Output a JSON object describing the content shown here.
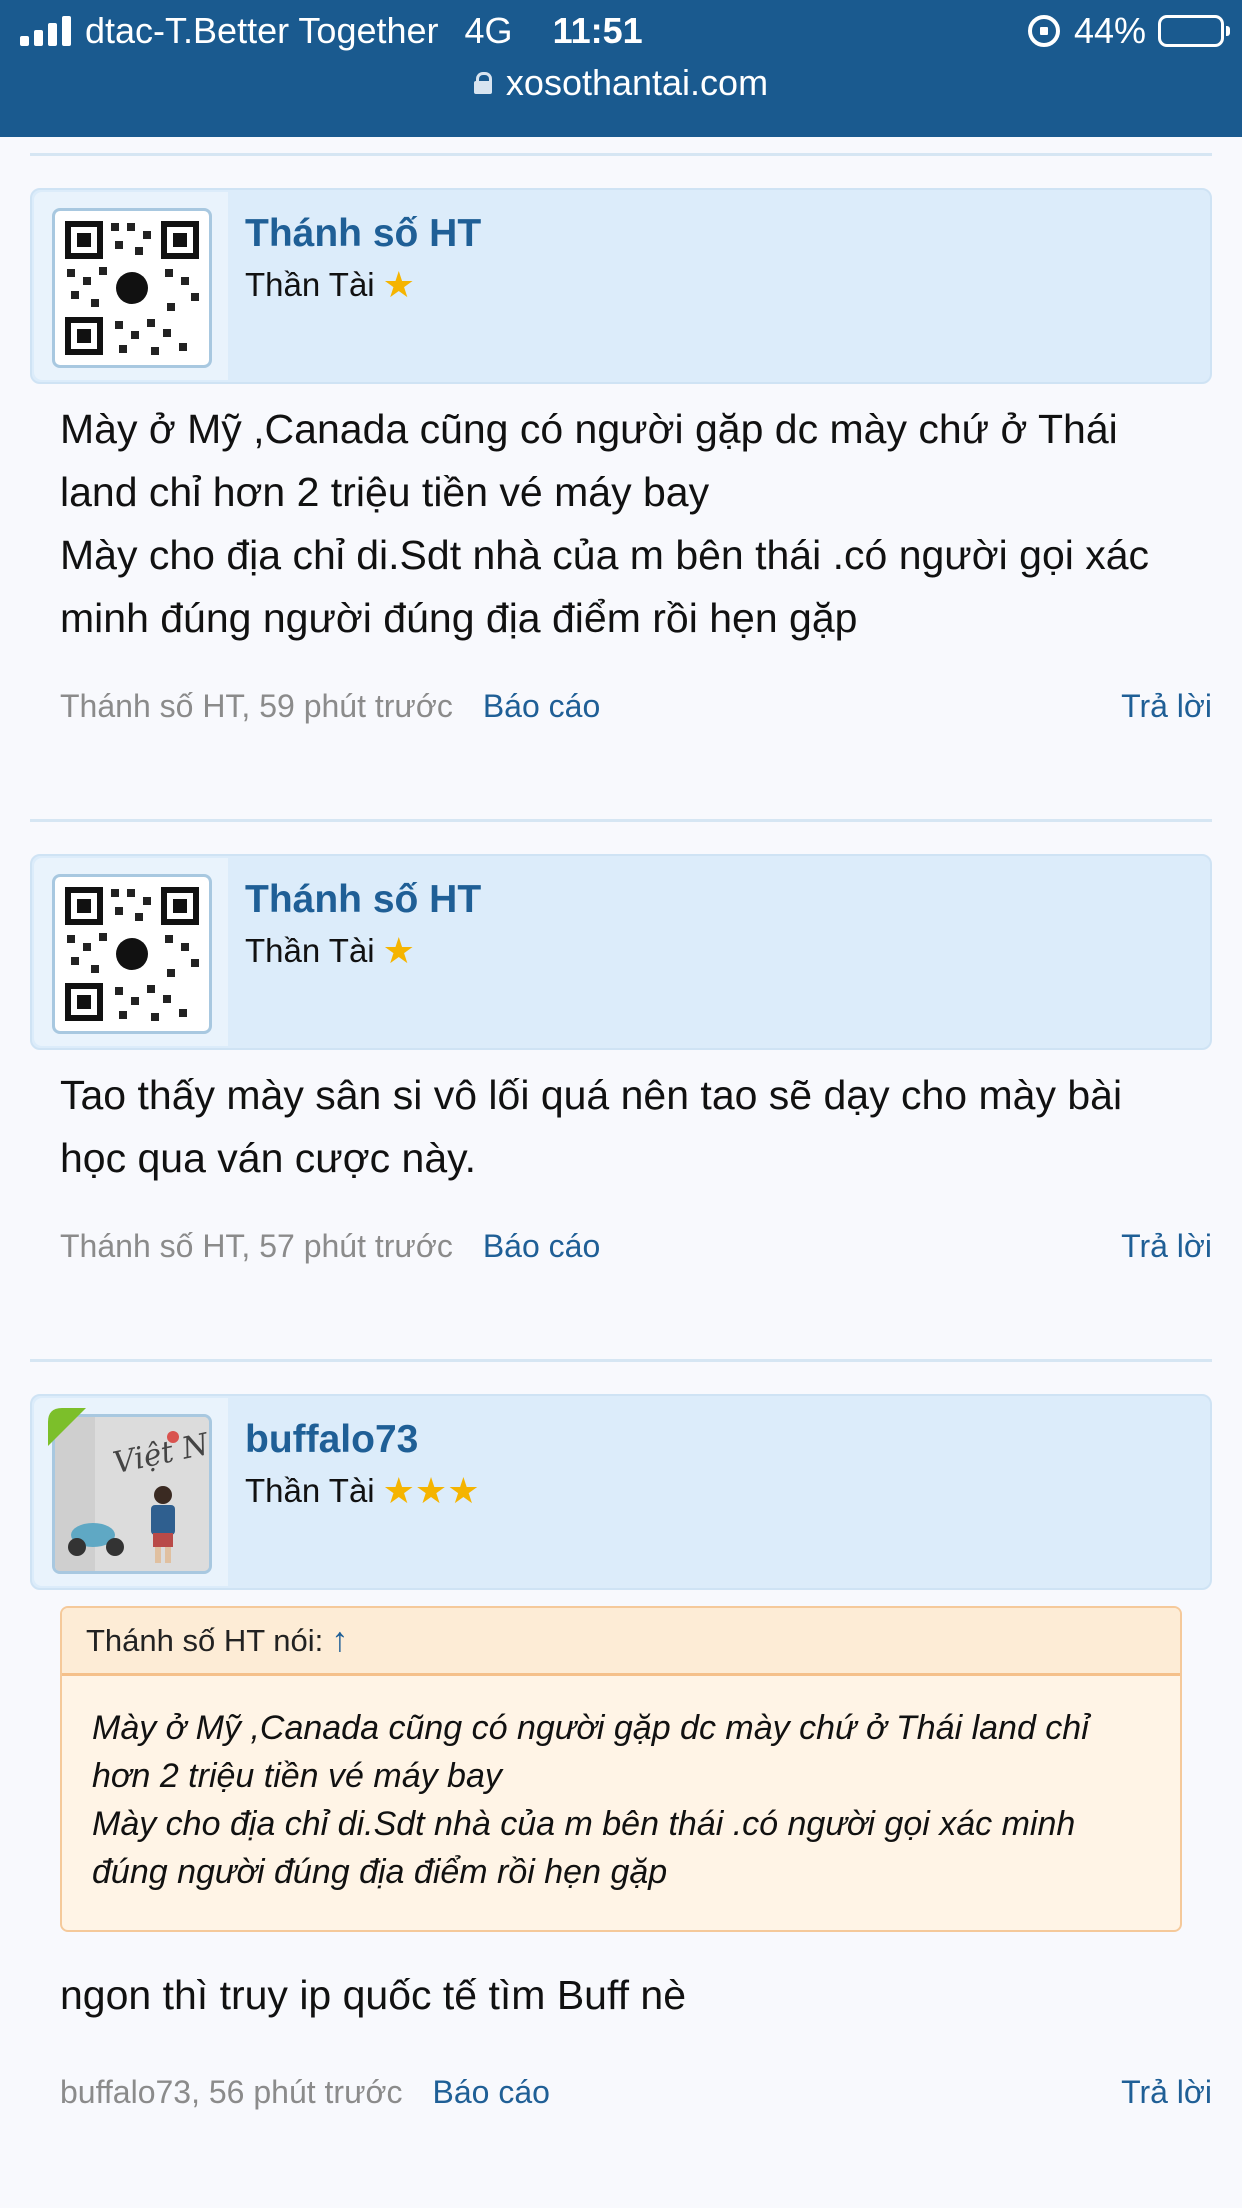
{
  "status_bar": {
    "carrier": "dtac-T.Better Together",
    "network": "4G",
    "time": "11:51",
    "battery": "44%",
    "battery_level": 0.44
  },
  "address_bar": {
    "url": "xosothantai.com"
  },
  "posts": [
    {
      "username": "Thánh số HT",
      "rank": "Thần Tài",
      "stars": 1,
      "message": [
        "Mày ở Mỹ ,Canada cũng có người gặp dc mày chứ ở Thái land chỉ hơn 2 triệu tiền vé máy bay",
        "Mày cho địa chỉ di.Sdt nhà của m bên thái .có người gọi xác minh đúng người đúng địa điểm rồi hẹn gặp"
      ],
      "byline": "Thánh số HT, 59 phút trước",
      "report_label": "Báo cáo",
      "reply_label": "Trả lời"
    },
    {
      "username": "Thánh số HT",
      "rank": "Thần Tài",
      "stars": 1,
      "message": [
        "Tao thấy mày sân si vô lối quá nên tao sẽ dạy cho mày bài học qua ván cược này."
      ],
      "byline": "Thánh số HT, 57 phút trước",
      "report_label": "Báo cáo",
      "reply_label": "Trả lời"
    },
    {
      "username": "buffalo73",
      "rank": "Thần Tài",
      "stars": 3,
      "quote": {
        "header": "Thánh số HT nói:",
        "arrow": "↑",
        "lines": [
          "Mày ở Mỹ ,Canada cũng có người gặp dc mày chứ ở Thái land chỉ hơn 2 triệu tiền vé máy bay",
          "Mày cho địa chỉ di.Sdt nhà của m bên thái .có người gọi xác minh đúng người đúng địa điểm rồi hẹn gặp"
        ]
      },
      "message": [
        "ngon thì truy ip quốc tế tìm Buff nè"
      ],
      "byline": "buffalo73, 56 phút trước",
      "report_label": "Báo cáo",
      "reply_label": "Trả lời"
    }
  ],
  "colors": {
    "header_bg": "#1a5a8f",
    "link": "#1f5f96",
    "user_bar": "#dcecfa",
    "quote_bg": "#fff4e6",
    "star": "#f5b400"
  }
}
